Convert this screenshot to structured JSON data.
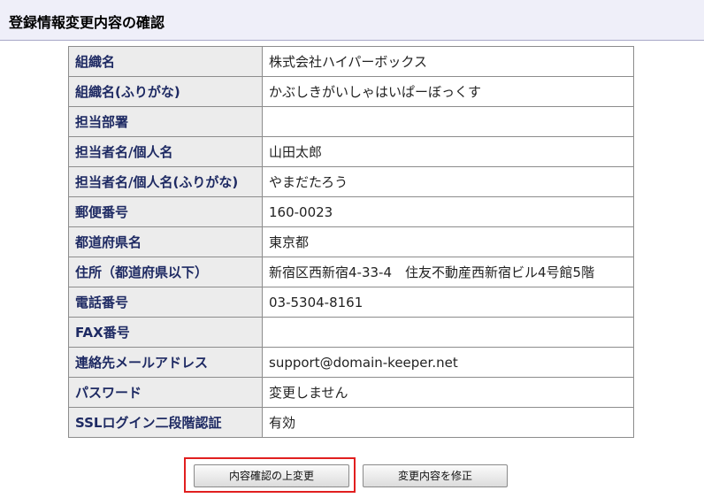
{
  "header": {
    "title": "登録情報変更内容の確認"
  },
  "rows": [
    {
      "label": "組織名",
      "value": "株式会社ハイパーボックス"
    },
    {
      "label": "組織名(ふりがな)",
      "value": "かぶしきがいしゃはいぱーぼっくす"
    },
    {
      "label": "担当部署",
      "value": ""
    },
    {
      "label": "担当者名/個人名",
      "value": "山田太郎"
    },
    {
      "label": "担当者名/個人名(ふりがな)",
      "value": "やまだたろう"
    },
    {
      "label": "郵便番号",
      "value": "160-0023"
    },
    {
      "label": "都道府県名",
      "value": "東京都"
    },
    {
      "label": "住所（都道府県以下）",
      "value": "新宿区西新宿4-33-4　住友不動産西新宿ビル4号館5階"
    },
    {
      "label": "電話番号",
      "value": "03-5304-8161"
    },
    {
      "label": "FAX番号",
      "value": ""
    },
    {
      "label": "連絡先メールアドレス",
      "value": "support@domain-keeper.net"
    },
    {
      "label": "パスワード",
      "value": "変更しません"
    },
    {
      "label": "SSLログイン二段階認証",
      "value": "有効"
    }
  ],
  "buttons": {
    "confirm_label": "内容確認の上変更",
    "fix_label": "変更内容を修正"
  },
  "colors": {
    "header_bg": "#efeff9",
    "label_bg": "#ececec",
    "label_text": "#1e2a63",
    "highlight": "#e11f1f"
  }
}
